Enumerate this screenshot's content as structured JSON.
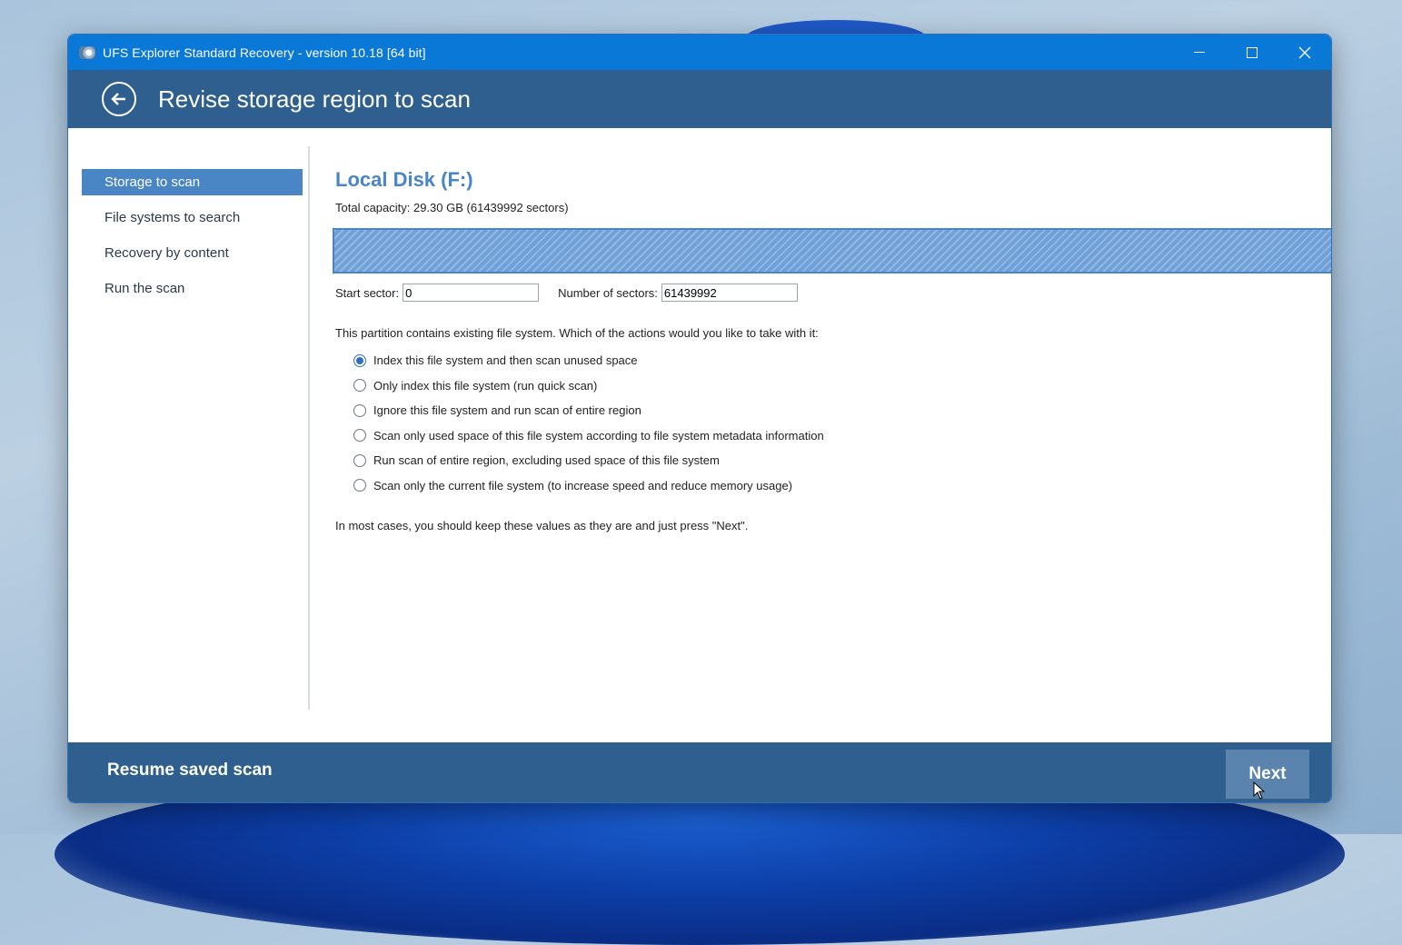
{
  "window": {
    "title": "UFS Explorer Standard Recovery - version 10.18 [64 bit]"
  },
  "header": {
    "title": "Revise storage region to scan"
  },
  "sidebar": {
    "items": [
      {
        "label": "Storage to scan",
        "active": true
      },
      {
        "label": "File systems to search",
        "active": false
      },
      {
        "label": "Recovery by content",
        "active": false
      },
      {
        "label": "Run the scan",
        "active": false
      }
    ]
  },
  "main": {
    "disk_name": "Local Disk (F:)",
    "capacity": "Total capacity: 29.30 GB (61439992 sectors)",
    "start_sector_label": "Start sector:",
    "start_sector_value": "0",
    "num_sectors_label": "Number of sectors:",
    "num_sectors_value": "61439992",
    "question": "This partition contains existing file system. Which of the actions would you like to take with it:",
    "options": [
      {
        "label": "Index this file system and then scan unused space",
        "selected": true
      },
      {
        "label": "Only index this file system (run quick scan)",
        "selected": false
      },
      {
        "label": "Ignore this file system and run scan of entire region",
        "selected": false
      },
      {
        "label": "Scan only used space of this file system according to file system metadata information",
        "selected": false
      },
      {
        "label": "Run scan of entire region, excluding used space of this file system",
        "selected": false
      },
      {
        "label": "Scan only the current file system (to increase speed and reduce memory usage)",
        "selected": false
      }
    ],
    "hint": "In most cases, you should keep these values as they are and just press \"Next\"."
  },
  "footer": {
    "resume_label": "Resume saved scan",
    "next_label": "Next"
  },
  "colors": {
    "titlebar": "#0a78d7",
    "header": "#2f5f8e",
    "accent": "#4a86c6",
    "next_button": "#5a83ad"
  },
  "icons": {
    "app": "app-icon",
    "back": "back-arrow-icon",
    "minimize": "minimize-icon",
    "maximize": "maximize-icon",
    "close": "close-icon",
    "cursor": "mouse-pointer-icon"
  }
}
